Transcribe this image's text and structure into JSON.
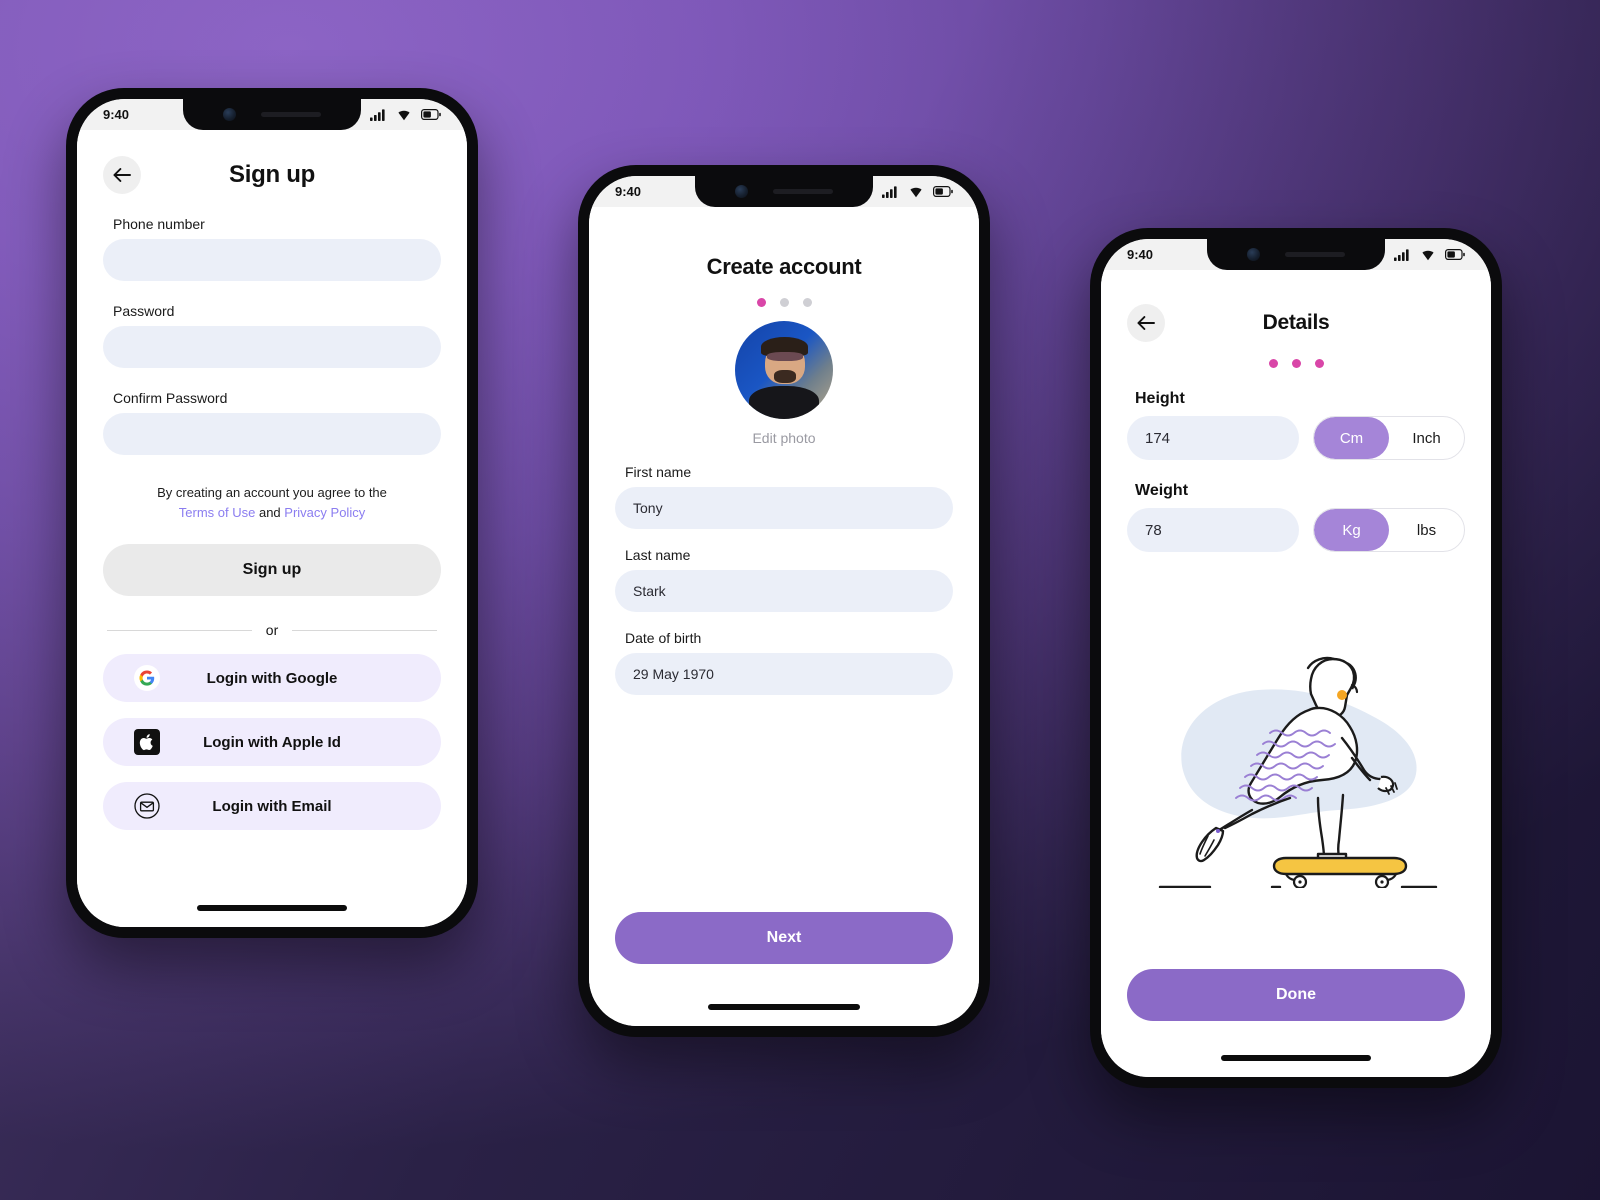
{
  "background": {
    "accent": "#8b6ac7",
    "link": "#8b7df0",
    "dot_active": "#d946a8"
  },
  "statusbar": {
    "time": "9:40",
    "signal_icon": "signal-bars-icon",
    "wifi_icon": "wifi-icon",
    "battery_icon": "battery-icon"
  },
  "screen1": {
    "back_icon": "back-arrow-icon",
    "title": "Sign up",
    "fields": [
      {
        "label": "Phone number",
        "value": "",
        "placeholder": ""
      },
      {
        "label": "Password",
        "value": "",
        "placeholder": ""
      },
      {
        "label": "Confirm Password",
        "value": "",
        "placeholder": ""
      }
    ],
    "legal": {
      "prefix": "By creating an account you agree to the",
      "terms": "Terms of Use",
      "conjunction": "and",
      "privacy": "Privacy Policy"
    },
    "submit_label": "Sign up",
    "divider_label": "or",
    "social": [
      {
        "label": "Login with Google",
        "icon": "google-icon"
      },
      {
        "label": "Login with Apple Id",
        "icon": "apple-icon"
      },
      {
        "label": "Login with Email",
        "icon": "email-icon"
      }
    ]
  },
  "screen2": {
    "title": "Create account",
    "dots": [
      true,
      false,
      false
    ],
    "avatar_alt": "profile-photo",
    "edit_photo_label": "Edit photo",
    "fields": [
      {
        "label": "First name",
        "value": "Tony"
      },
      {
        "label": "Last name",
        "value": "Stark"
      },
      {
        "label": "Date of birth",
        "value": "29 May 1970"
      }
    ],
    "next_label": "Next"
  },
  "screen3": {
    "back_icon": "back-arrow-icon",
    "title": "Details",
    "dots": [
      true,
      true,
      true
    ],
    "metrics": [
      {
        "label": "Height",
        "value": "174",
        "units": [
          "Cm",
          "Inch"
        ],
        "selected": "Cm"
      },
      {
        "label": "Weight",
        "value": "78",
        "units": [
          "Kg",
          "lbs"
        ],
        "selected": "Kg"
      }
    ],
    "illustration": "skateboarder-illustration",
    "done_label": "Done"
  }
}
